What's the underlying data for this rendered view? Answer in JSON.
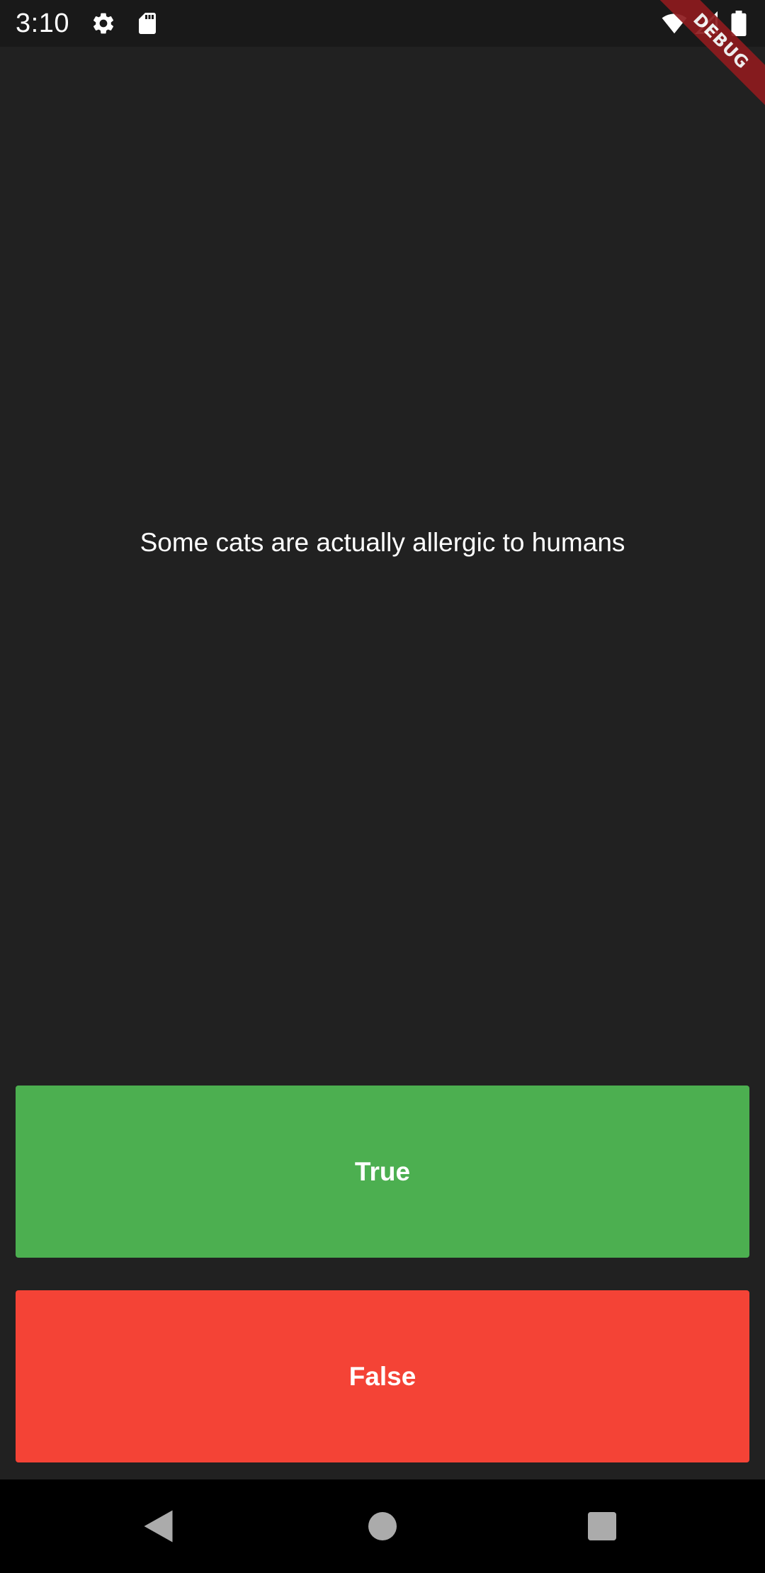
{
  "status_bar": {
    "time": "3:10",
    "icons": [
      "settings-icon",
      "sd-card-icon",
      "wifi-icon",
      "signal-icon",
      "battery-icon"
    ]
  },
  "debug_banner": {
    "label": "DEBUG",
    "color": "#8e1b1e"
  },
  "quiz": {
    "question": "Some cats are actually allergic to humans",
    "true_button": {
      "label": "True",
      "color": "#4caf50"
    },
    "false_button": {
      "label": "False",
      "color": "#f44336"
    }
  },
  "nav_bar": {
    "icons": [
      "back-icon",
      "home-icon",
      "recents-icon"
    ]
  },
  "colors": {
    "background": "#212121",
    "status_bar": "#191919",
    "nav_bar": "#000000",
    "text": "#ffffff"
  }
}
